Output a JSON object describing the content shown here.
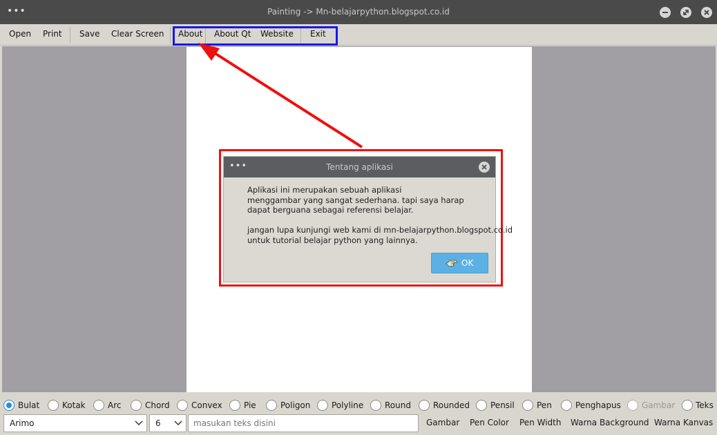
{
  "window": {
    "title": "Painting -> Mn-belajarpython.blogspot.co.id",
    "menu_dots": "•••"
  },
  "toolbar": {
    "open": "Open",
    "print": "Print",
    "save": "Save",
    "clear": "Clear Screen",
    "about": "About",
    "about_qt": "About Qt",
    "website": "Website",
    "exit": "Exit"
  },
  "dialog": {
    "dots": "•••",
    "title": "Tentang aplikasi",
    "lines": [
      "Aplikasi ini merupakan sebuah aplikasi",
      "menggambar yang sangat sederhana. tapi saya harap",
      "dapat berguana sebagai referensi belajar.",
      "",
      "jangan lupa kunjungi web kami di mn-belajarpython.blogspot.co.id",
      "untuk tutorial belajar python yang lainnya."
    ],
    "ok": "OK"
  },
  "shapes": {
    "selected": "Bulat",
    "items": [
      "Bulat",
      "Kotak",
      "Arc",
      "Chord",
      "Convex",
      "Pie",
      "Poligon",
      "Polyline",
      "Round",
      "Rounded",
      "Pensil",
      "Pen",
      "Penghapus",
      "Gambar",
      "Teks"
    ],
    "disabled": "Gambar"
  },
  "bottom": {
    "font_value": "Arimo",
    "size_value": "6",
    "text_placeholder": "masukan teks disini",
    "gambar": "Gambar",
    "pen_color": "Pen Color",
    "pen_width": "Pen Width",
    "warna_background": "Warna Background",
    "warna_kanvas": "Warna Kanvas"
  },
  "colors": {
    "accent": "#2e8bd2",
    "annotation_red": "#ef0f0f",
    "annotation_blue": "#1717e8",
    "ok_button": "#5bb1e4"
  }
}
